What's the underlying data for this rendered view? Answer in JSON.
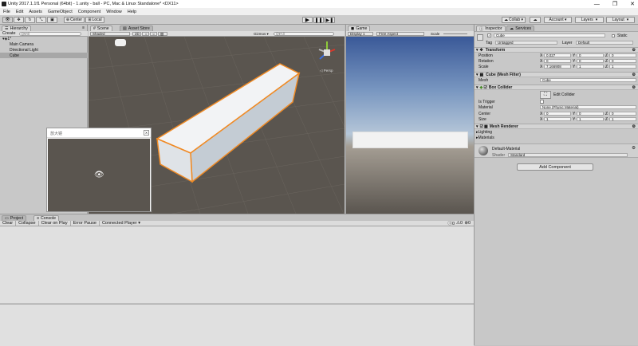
{
  "window": {
    "title": "Unity 2017.1.1f1 Personal (64bit) - 1.unity - ball - PC, Mac & Linux Standalone* <DX11>",
    "controls": [
      "—",
      "❐",
      "✕"
    ]
  },
  "menu": [
    "File",
    "Edit",
    "Assets",
    "GameObject",
    "Component",
    "Window",
    "Help"
  ],
  "toolbar": {
    "pivot_label": "Center",
    "space_label": "Local",
    "collab_label": "Collab ▾",
    "layers_label": "Layers",
    "layout_label": "Layout"
  },
  "hierarchy": {
    "tab": "Hierarchy",
    "create_label": "Create",
    "search_placeholder": "Q▾All",
    "scene_name": "1*",
    "items": [
      "Main Camera",
      "Directional Light",
      "Cube"
    ]
  },
  "scene": {
    "tabs": [
      "Scene",
      "Asset Store"
    ],
    "shading": "Shaded",
    "mode_2d": "2D",
    "gizmos": "Gizmos ▾",
    "search": "Q▾All",
    "persp": "◁ Persp",
    "overlay_title": "放大镜"
  },
  "game": {
    "tab": "Game",
    "display": "Display 1",
    "aspect": "Free Aspect",
    "scale": "Scale"
  },
  "inspector": {
    "tabs": [
      "Inspector",
      "Services"
    ],
    "object_name": "Cube",
    "static_label": "Static",
    "tag_label": "Tag",
    "tag_value": "Untagged",
    "layer_label": "Layer",
    "layer_value": "Default",
    "transform": {
      "header": "Transform",
      "rows": [
        {
          "label": "Position",
          "x": "0.027",
          "y": "0",
          "z": "0"
        },
        {
          "label": "Rotation",
          "x": "0",
          "y": "0",
          "z": "0"
        },
        {
          "label": "Scale",
          "x": "7.166908",
          "y": "1",
          "z": "1"
        }
      ]
    },
    "mesh_filter": {
      "header": "Cube (Mesh Filter)",
      "mesh_label": "Mesh",
      "mesh_value": "Cube"
    },
    "box_collider": {
      "header": "Box Collider",
      "edit_label": "Edit Collider",
      "is_trigger_label": "Is Trigger",
      "material_label": "Material",
      "material_value": "None (Physic Material)",
      "center_label": "Center",
      "center": {
        "x": "0",
        "y": "0",
        "z": "0"
      },
      "size_label": "Size",
      "size": {
        "x": "1",
        "y": "1",
        "z": "1"
      }
    },
    "mesh_renderer": {
      "header": "Mesh Renderer",
      "lighting": "Lighting",
      "materials": "Materials"
    },
    "material": {
      "name": "Default-Material",
      "shader_label": "Shader",
      "shader_value": "Standard"
    },
    "add_component": "Add Component"
  },
  "console": {
    "tabs": [
      "Project",
      "Console"
    ],
    "buttons": [
      "Clear",
      "Collapse",
      "Clear on Play",
      "Error Pause",
      "Connected Player ▾"
    ],
    "counts": [
      "0",
      "0",
      "0"
    ]
  },
  "colors": {
    "selection": "#3e7ce6",
    "outline": "#f08a24",
    "scene_bg": "#5a554f"
  }
}
